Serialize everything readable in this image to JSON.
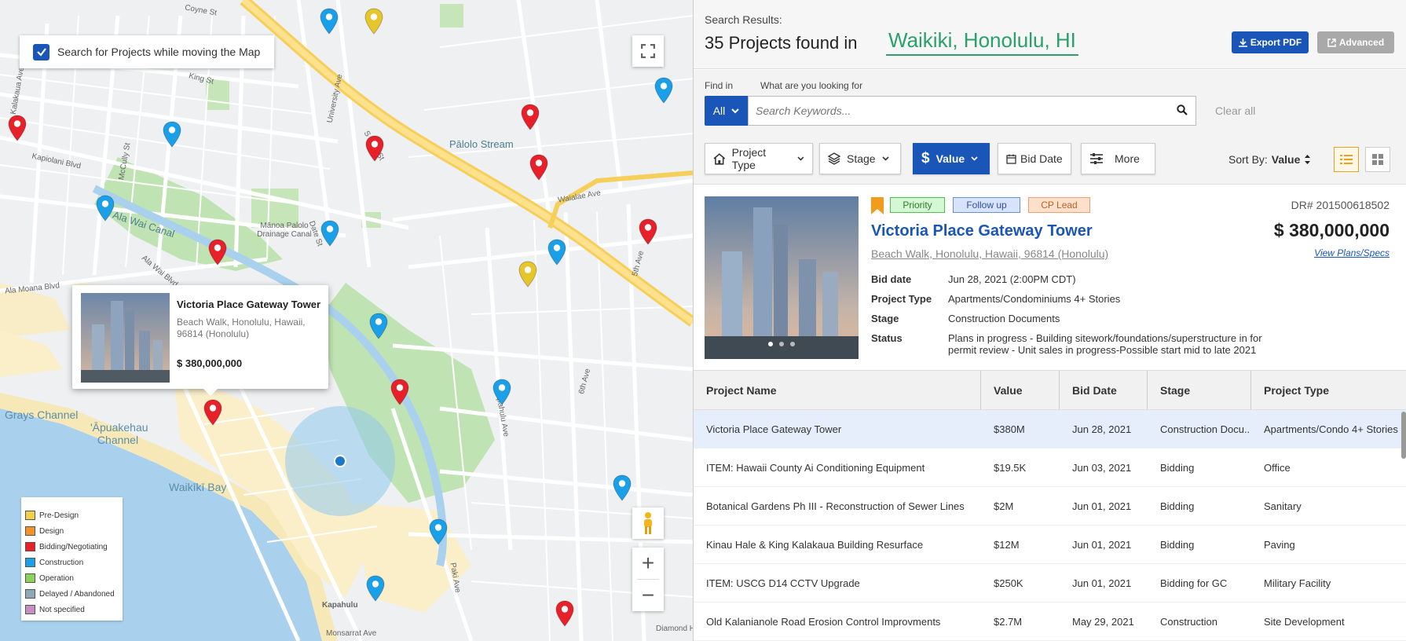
{
  "map": {
    "search_toggle_label": "Search for Projects while moving the Map",
    "search_toggle_checked": true,
    "labels": [
      {
        "text": "Kapiolani Blvd",
        "key": "l1"
      },
      {
        "text": "Kalakaua Ave",
        "key": "l2"
      },
      {
        "text": "McCully St",
        "key": "l3"
      },
      {
        "text": "Ala Wai Canal",
        "key": "l4"
      },
      {
        "text": "Ala Wai Blvd",
        "key": "l5"
      },
      {
        "text": "Ala Moana Blvd",
        "key": "l6"
      },
      {
        "text": "Mānoa Palolo Drainage Canal",
        "key": "l7"
      },
      {
        "text": "University Ave",
        "key": "l8"
      },
      {
        "text": "Pālolo Stream",
        "key": "l9"
      },
      {
        "text": "Waialae Ave",
        "key": "l10"
      },
      {
        "text": "Kapahulu Ave",
        "key": "l11"
      },
      {
        "text": "6th Ave",
        "key": "l12"
      },
      {
        "text": "5th Ave",
        "key": "l13"
      },
      {
        "text": "Grays Channel",
        "key": "l14"
      },
      {
        "text": "'Āpuakehau Channel",
        "key": "l15"
      },
      {
        "text": "Waikīkī Bay",
        "key": "l16"
      },
      {
        "text": "Paki Ave",
        "key": "l17"
      },
      {
        "text": "Monsarrat Ave",
        "key": "l18"
      },
      {
        "text": "Kapahulu",
        "key": "l19"
      },
      {
        "text": "Diamond H",
        "key": "l20"
      },
      {
        "text": "King St",
        "key": "l21"
      },
      {
        "text": "S King St",
        "key": "l22"
      },
      {
        "text": "Date St",
        "key": "l23"
      },
      {
        "text": "Coyne St",
        "key": "l24"
      }
    ],
    "popup": {
      "title": "Victoria Place Gateway Tower",
      "address": "Beach Walk, Honolulu, Hawaii, 96814 (Honolulu)",
      "value": "$ 380,000,000"
    },
    "legend": [
      {
        "label": "Pre-Design",
        "color": "#f2d14a"
      },
      {
        "label": "Design",
        "color": "#f5912a"
      },
      {
        "label": "Bidding/Negotiating",
        "color": "#e8202a"
      },
      {
        "label": "Construction",
        "color": "#1aa0e8"
      },
      {
        "label": "Operation",
        "color": "#8ed15a"
      },
      {
        "label": "Delayed / Abandoned",
        "color": "#8fa8b8"
      },
      {
        "label": "Not specified",
        "color": "#c58fc0"
      }
    ],
    "zoom_in": "+",
    "zoom_out": "−"
  },
  "header": {
    "search_results_label": "Search Results:",
    "count_text": "35 Projects found in",
    "location": "Waikiki, Honolulu, HI",
    "export_label": "Export PDF",
    "advanced_label": "Advanced"
  },
  "search": {
    "find_in_label": "Find in",
    "what_label": "What are you looking for",
    "find_in_value": "All",
    "keyword_placeholder": "Search Keywords...",
    "clear_all": "Clear all"
  },
  "filters": [
    {
      "label": "Project Type",
      "active": false
    },
    {
      "label": "Stage",
      "active": false
    },
    {
      "label": "Value",
      "active": true
    },
    {
      "label": "Bid Date",
      "active": false
    },
    {
      "label": "More",
      "active": false
    }
  ],
  "sort": {
    "label": "Sort By:",
    "value": "Value"
  },
  "detail": {
    "tags": [
      "Priority",
      "Follow up",
      "CP Lead"
    ],
    "title": "Victoria Place Gateway Tower",
    "address": "Beach Walk, Honolulu, Hawaii, 96814 (Honolulu)",
    "dr": "DR# 201500618502",
    "value": "$ 380,000,000",
    "view_plans": "View Plans/Specs",
    "fields": [
      {
        "k": "Bid date",
        "v": "Jun 28, 2021 (2:00PM CDT)"
      },
      {
        "k": "Project Type",
        "v": "Apartments/Condominiums 4+ Stories"
      },
      {
        "k": "Stage",
        "v": "Construction Documents"
      },
      {
        "k": "Status",
        "v": "Plans in progress - Building sitework/foundations/superstructure in for permit review - Unit sales  in progress-Possible start mid to late 2021"
      }
    ]
  },
  "table": {
    "columns": [
      "Project Name",
      "Value",
      "Bid Date",
      "Stage",
      "Project Type"
    ],
    "rows": [
      [
        "Victoria Place Gateway Tower",
        "$380M",
        "Jun 28, 2021",
        "Construction Docu..",
        "Apartments/Condo 4+ Stories"
      ],
      [
        "ITEM: Hawaii County Ai Conditioning Equipment",
        "$19.5K",
        "Jun 03, 2021",
        "Bidding",
        "Office"
      ],
      [
        "Botanical Gardens Ph III - Reconstruction of Sewer Lines",
        "$2M",
        "Jun 01, 2021",
        "Bidding",
        "Sanitary"
      ],
      [
        "Kinau Hale & King Kalakaua Building Resurface",
        "$12M",
        "Jun 01, 2021",
        "Bidding",
        "Paving"
      ],
      [
        "ITEM: USCG D14 CCTV Upgrade",
        "$250K",
        "Jun 01, 2021",
        "Bidding for GC",
        "Military Facility"
      ],
      [
        "Old Kalanianole Road Erosion Control Improvments",
        "$2.7M",
        "May 29, 2021",
        "Construction",
        "Site Development"
      ]
    ]
  },
  "colors": {
    "accent": "#1a56b8",
    "location": "#2aa06a",
    "bid_pin": "#e8202a",
    "construction_pin": "#1aa0e8",
    "predesign_pin": "#e6c62a"
  }
}
